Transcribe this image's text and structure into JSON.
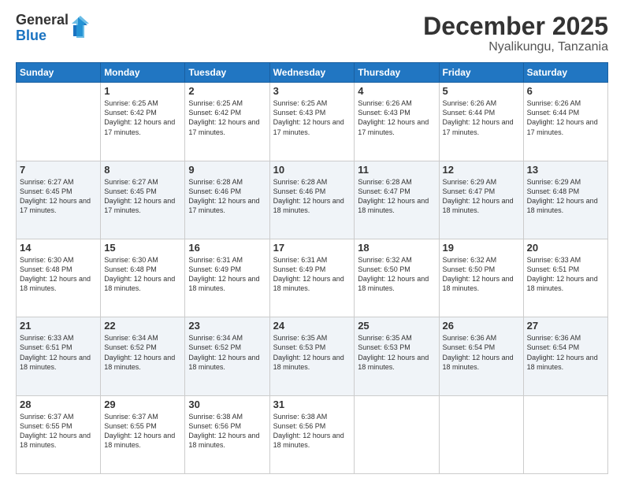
{
  "logo": {
    "general": "General",
    "blue": "Blue"
  },
  "header": {
    "month": "December 2025",
    "location": "Nyalikungu, Tanzania"
  },
  "days_of_week": [
    "Sunday",
    "Monday",
    "Tuesday",
    "Wednesday",
    "Thursday",
    "Friday",
    "Saturday"
  ],
  "weeks": [
    [
      {
        "day": "",
        "info": ""
      },
      {
        "day": "1",
        "info": "Sunrise: 6:25 AM\nSunset: 6:42 PM\nDaylight: 12 hours and 17 minutes."
      },
      {
        "day": "2",
        "info": "Sunrise: 6:25 AM\nSunset: 6:42 PM\nDaylight: 12 hours and 17 minutes."
      },
      {
        "day": "3",
        "info": "Sunrise: 6:25 AM\nSunset: 6:43 PM\nDaylight: 12 hours and 17 minutes."
      },
      {
        "day": "4",
        "info": "Sunrise: 6:26 AM\nSunset: 6:43 PM\nDaylight: 12 hours and 17 minutes."
      },
      {
        "day": "5",
        "info": "Sunrise: 6:26 AM\nSunset: 6:44 PM\nDaylight: 12 hours and 17 minutes."
      },
      {
        "day": "6",
        "info": "Sunrise: 6:26 AM\nSunset: 6:44 PM\nDaylight: 12 hours and 17 minutes."
      }
    ],
    [
      {
        "day": "7",
        "info": "Sunrise: 6:27 AM\nSunset: 6:45 PM\nDaylight: 12 hours and 17 minutes."
      },
      {
        "day": "8",
        "info": "Sunrise: 6:27 AM\nSunset: 6:45 PM\nDaylight: 12 hours and 17 minutes."
      },
      {
        "day": "9",
        "info": "Sunrise: 6:28 AM\nSunset: 6:46 PM\nDaylight: 12 hours and 17 minutes."
      },
      {
        "day": "10",
        "info": "Sunrise: 6:28 AM\nSunset: 6:46 PM\nDaylight: 12 hours and 18 minutes."
      },
      {
        "day": "11",
        "info": "Sunrise: 6:28 AM\nSunset: 6:47 PM\nDaylight: 12 hours and 18 minutes."
      },
      {
        "day": "12",
        "info": "Sunrise: 6:29 AM\nSunset: 6:47 PM\nDaylight: 12 hours and 18 minutes."
      },
      {
        "day": "13",
        "info": "Sunrise: 6:29 AM\nSunset: 6:48 PM\nDaylight: 12 hours and 18 minutes."
      }
    ],
    [
      {
        "day": "14",
        "info": "Sunrise: 6:30 AM\nSunset: 6:48 PM\nDaylight: 12 hours and 18 minutes."
      },
      {
        "day": "15",
        "info": "Sunrise: 6:30 AM\nSunset: 6:48 PM\nDaylight: 12 hours and 18 minutes."
      },
      {
        "day": "16",
        "info": "Sunrise: 6:31 AM\nSunset: 6:49 PM\nDaylight: 12 hours and 18 minutes."
      },
      {
        "day": "17",
        "info": "Sunrise: 6:31 AM\nSunset: 6:49 PM\nDaylight: 12 hours and 18 minutes."
      },
      {
        "day": "18",
        "info": "Sunrise: 6:32 AM\nSunset: 6:50 PM\nDaylight: 12 hours and 18 minutes."
      },
      {
        "day": "19",
        "info": "Sunrise: 6:32 AM\nSunset: 6:50 PM\nDaylight: 12 hours and 18 minutes."
      },
      {
        "day": "20",
        "info": "Sunrise: 6:33 AM\nSunset: 6:51 PM\nDaylight: 12 hours and 18 minutes."
      }
    ],
    [
      {
        "day": "21",
        "info": "Sunrise: 6:33 AM\nSunset: 6:51 PM\nDaylight: 12 hours and 18 minutes."
      },
      {
        "day": "22",
        "info": "Sunrise: 6:34 AM\nSunset: 6:52 PM\nDaylight: 12 hours and 18 minutes."
      },
      {
        "day": "23",
        "info": "Sunrise: 6:34 AM\nSunset: 6:52 PM\nDaylight: 12 hours and 18 minutes."
      },
      {
        "day": "24",
        "info": "Sunrise: 6:35 AM\nSunset: 6:53 PM\nDaylight: 12 hours and 18 minutes."
      },
      {
        "day": "25",
        "info": "Sunrise: 6:35 AM\nSunset: 6:53 PM\nDaylight: 12 hours and 18 minutes."
      },
      {
        "day": "26",
        "info": "Sunrise: 6:36 AM\nSunset: 6:54 PM\nDaylight: 12 hours and 18 minutes."
      },
      {
        "day": "27",
        "info": "Sunrise: 6:36 AM\nSunset: 6:54 PM\nDaylight: 12 hours and 18 minutes."
      }
    ],
    [
      {
        "day": "28",
        "info": "Sunrise: 6:37 AM\nSunset: 6:55 PM\nDaylight: 12 hours and 18 minutes."
      },
      {
        "day": "29",
        "info": "Sunrise: 6:37 AM\nSunset: 6:55 PM\nDaylight: 12 hours and 18 minutes."
      },
      {
        "day": "30",
        "info": "Sunrise: 6:38 AM\nSunset: 6:56 PM\nDaylight: 12 hours and 18 minutes."
      },
      {
        "day": "31",
        "info": "Sunrise: 6:38 AM\nSunset: 6:56 PM\nDaylight: 12 hours and 18 minutes."
      },
      {
        "day": "",
        "info": ""
      },
      {
        "day": "",
        "info": ""
      },
      {
        "day": "",
        "info": ""
      }
    ]
  ]
}
